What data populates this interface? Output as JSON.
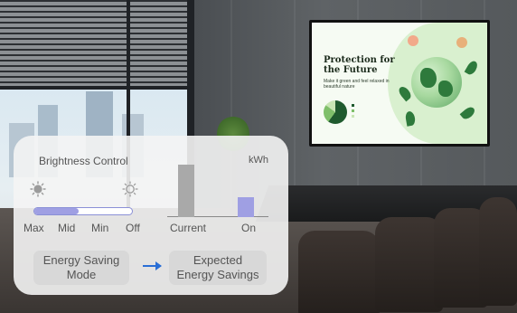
{
  "panel": {
    "title": "Brightness Control",
    "unit": "kWh",
    "brightness_levels": [
      "Max",
      "Mid",
      "Min",
      "Off"
    ],
    "brightness_level_fill": 0.45,
    "chart_bars": [
      "Current",
      "On"
    ],
    "chart_values": [
      1.0,
      0.38
    ],
    "chart_colors": [
      "#a9a9a9",
      "#9f9fe3"
    ],
    "buttons": {
      "energy_saving_mode": "Energy Saving\nMode",
      "expected_savings": "Expected\nEnergy Savings"
    },
    "accent_color": "#2a6fd6",
    "icons": [
      "sun-bright-icon",
      "sun-dim-icon",
      "arrow-right-icon"
    ]
  },
  "tv_content": {
    "title": "Protection for the Future",
    "subtitle": "Make it green and feel relaxed in beautiful nature"
  }
}
